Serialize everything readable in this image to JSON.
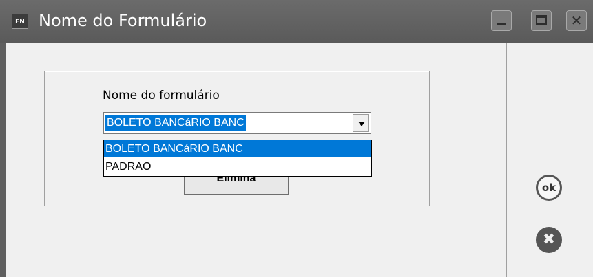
{
  "window": {
    "title": "Nome do Formulário",
    "app_icon_text": "FN",
    "icons": {
      "minimize": "minimize-icon",
      "maximize": "maximize-icon",
      "close": "close-icon"
    }
  },
  "form": {
    "field_label": "Nome do formulário",
    "selected_value": "BOLETO BANCáRIO BANC",
    "options": [
      "BOLETO BANCáRIO BANC",
      "PADRAO"
    ],
    "highlighted_option_index": 0,
    "elimina_button_label": "Elimina"
  },
  "side_actions": {
    "ok_label": "ok",
    "cancel_icon": "cancel-x-icon"
  },
  "colors": {
    "titlebar": "#5e5e5e",
    "selection": "#0078d7",
    "background": "#f0f0f0"
  }
}
